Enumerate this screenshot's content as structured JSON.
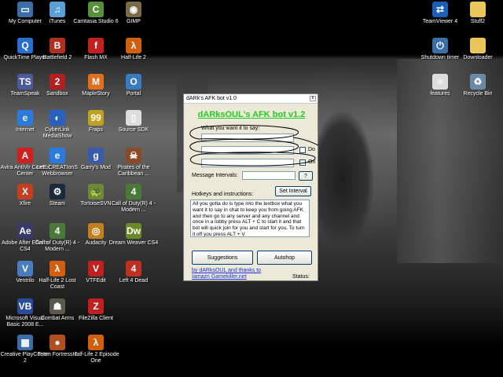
{
  "desktop": {
    "icons": [
      {
        "label": "My Computer",
        "name": "my-computer",
        "glyph": "▭",
        "color": "#3a6ea5"
      },
      {
        "label": "iTunes",
        "name": "itunes",
        "glyph": "♫",
        "color": "#5aa0d8"
      },
      {
        "label": "Camtasia Studio 6",
        "name": "camtasia",
        "glyph": "C",
        "color": "#5a8f3c"
      },
      {
        "label": "GIMP",
        "name": "gimp",
        "glyph": "◉",
        "color": "#7a6a4a"
      },
      {
        "label": "TeamViewer 4",
        "name": "teamviewer",
        "glyph": "⇄",
        "color": "#1a5fb4"
      },
      {
        "label": "Stuff2",
        "name": "stuff2",
        "glyph": "",
        "color": "#e8c65a"
      },
      {
        "label": "QuickTime Player",
        "name": "quicktime",
        "glyph": "Q",
        "color": "#2a6fd0"
      },
      {
        "label": "Battlefield 2",
        "name": "battlefield2",
        "glyph": "B",
        "color": "#b03020"
      },
      {
        "label": "Flash MX",
        "name": "flash-mx",
        "glyph": "f",
        "color": "#c02020"
      },
      {
        "label": "Half-Life 2",
        "name": "half-life-2",
        "glyph": "λ",
        "color": "#d06010"
      },
      {
        "label": "Shutdown timer",
        "name": "shutdown-timer",
        "glyph": "⏻",
        "color": "#3a6ea5"
      },
      {
        "label": "Downloader",
        "name": "downloader",
        "glyph": "",
        "color": "#e8c65a"
      },
      {
        "label": "TeamSpeak",
        "name": "teamspeak",
        "glyph": "TS",
        "color": "#4a5a9a"
      },
      {
        "label": "Sandbox",
        "name": "sandbox",
        "glyph": "2",
        "color": "#b02020"
      },
      {
        "label": "MapleStory",
        "name": "maplestory",
        "glyph": "M",
        "color": "#e07020"
      },
      {
        "label": "Portal",
        "name": "portal",
        "glyph": "O",
        "color": "#3a7ac0"
      },
      {
        "label": "features",
        "name": "features",
        "glyph": "≡",
        "color": "#dddddd"
      },
      {
        "label": "Recycle Bin",
        "name": "recycle-bin",
        "glyph": "♻",
        "color": "#6a8aa8"
      },
      {
        "label": "Internet",
        "name": "internet",
        "glyph": "e",
        "color": "#2a7ae0"
      },
      {
        "label": "CyberLink MediaShow",
        "name": "cyberlink-mediashow",
        "glyph": "◐",
        "color": "#2a60c0"
      },
      {
        "label": "Fraps",
        "name": "fraps",
        "glyph": "99",
        "color": "#c0a020"
      },
      {
        "label": "Source SDK",
        "name": "source-sdk",
        "glyph": "▯",
        "color": "#dddddd"
      },
      {
        "label": "Avira AntiVir Control Center",
        "name": "avira",
        "glyph": "A",
        "color": "#d02020"
      },
      {
        "label": "LeE CREATIonS Webbrowser",
        "name": "lee-creations-webbrowser",
        "glyph": "e",
        "color": "#2a7ae0"
      },
      {
        "label": "Garry's Mod",
        "name": "garrys-mod",
        "glyph": "g",
        "color": "#3a5ab0"
      },
      {
        "label": "Pirates of the Caribbean ...",
        "name": "pirates-caribbean",
        "glyph": "☠",
        "color": "#8a4a2a"
      },
      {
        "label": "Xfire",
        "name": "xfire",
        "glyph": "X",
        "color": "#c04020"
      },
      {
        "label": "Steam",
        "name": "steam",
        "glyph": "⚙",
        "color": "#1a2a3a"
      },
      {
        "label": "TortoiseSVN",
        "name": "tortoisesvn",
        "glyph": "🐢",
        "color": "#6a8a3a"
      },
      {
        "label": "Call of Duty(R) 4 - Modern ...",
        "name": "call-of-duty-4-a",
        "glyph": "4",
        "color": "#4a7a3a"
      },
      {
        "label": "Adobe After Effects CS4",
        "name": "after-effects",
        "glyph": "Ae",
        "color": "#3a3a6a"
      },
      {
        "label": "Call of Duty(R) 4 - Modern ...",
        "name": "call-of-duty-4-b",
        "glyph": "4",
        "color": "#4a7a3a"
      },
      {
        "label": "Audacity",
        "name": "audacity",
        "glyph": "◎",
        "color": "#c08020"
      },
      {
        "label": "Dream Weaver CS4",
        "name": "dreamweaver",
        "glyph": "Dw",
        "color": "#6a8a2a"
      },
      {
        "label": "Ventrilo",
        "name": "ventrilo",
        "glyph": "V",
        "color": "#4a7ac0"
      },
      {
        "label": "Half-Life 2 Lost Coast",
        "name": "half-life-2-lost-coast",
        "glyph": "λ",
        "color": "#d06010"
      },
      {
        "label": "VTFEdit",
        "name": "vtfedit",
        "glyph": "V",
        "color": "#c02020"
      },
      {
        "label": "Left 4 Dead",
        "name": "left-4-dead",
        "glyph": "4",
        "color": "#c03020"
      },
      {
        "label": "Microsoft Visual Basic 2008 E...",
        "name": "visual-basic",
        "glyph": "VB",
        "color": "#2a4a9a"
      },
      {
        "label": "Combat Arms",
        "name": "combat-arms",
        "glyph": "☗",
        "color": "#5a5a4a"
      },
      {
        "label": "FileZilla Client",
        "name": "filezilla",
        "glyph": "Z",
        "color": "#c02020"
      },
      {
        "label": "Creative PlayCenter 2",
        "name": "creative-playcenter",
        "glyph": "▦",
        "color": "#3a6ea5"
      },
      {
        "label": "Team Fortress 2",
        "name": "team-fortress-2",
        "glyph": "●",
        "color": "#b05020"
      },
      {
        "label": "Half-Life 2 Episode One",
        "name": "half-life-2-episode-one",
        "glyph": "λ",
        "color": "#d06010"
      }
    ]
  },
  "afk": {
    "window_title": "dARk's AFK bot v1.0",
    "close_glyph": "x",
    "heading": "dARksOUL's AFK bot v1.2",
    "say_label": "What you want it to say:",
    "say_value_1": "",
    "say_value_2": "",
    "say_value_3": "",
    "do_label": "Do",
    "on_label": "On",
    "interval_label": "Message Intervals:",
    "interval_value": "",
    "help_button": "?",
    "hotkeys_label": "Hotkeys and instructions:",
    "set_interval_button": "Set Interval",
    "instructions": "All you gotta do is type into the textbox what you want it to say in chat to keep you from going AFK and then go to any server and any channel and once in a lobby press ALT + C to start it and that bot will quick join for you and start for you. To turn it off you press ALT + V.",
    "suggestions_button": "Suggestions",
    "autohop_button": "Autohop",
    "credit": "by dARksOUL and thanks to Iamazn Gamekiller.net",
    "status_label": "Status:"
  }
}
